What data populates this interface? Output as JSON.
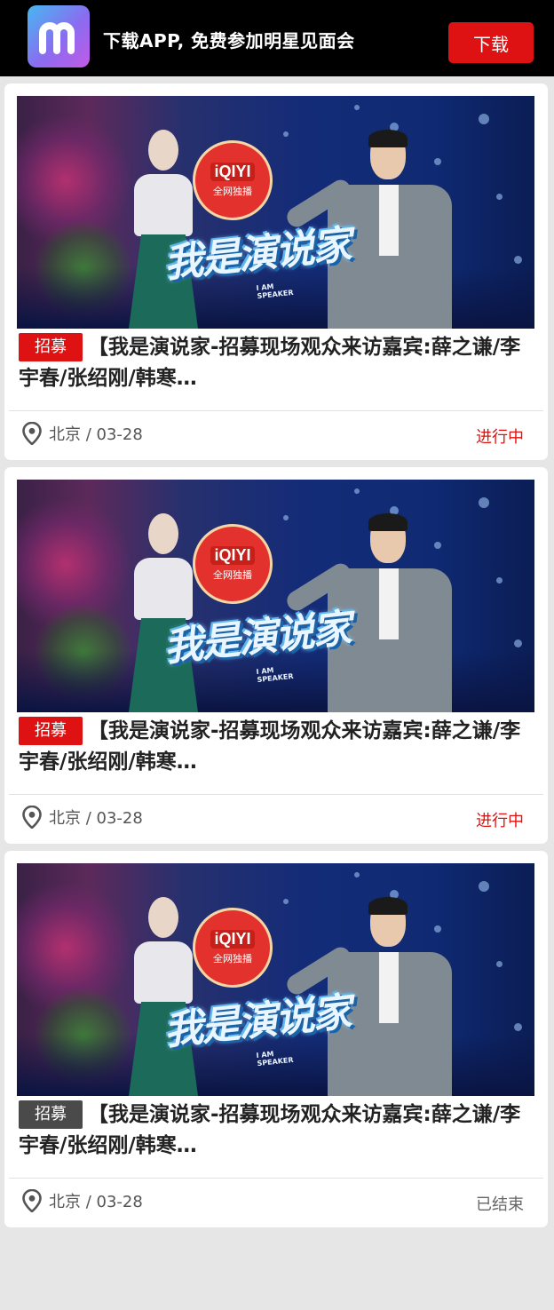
{
  "topbar": {
    "logo_letter": "m",
    "promo_text": "下载APP, 免费参加明星见面会",
    "download_label": "下载"
  },
  "colors": {
    "accent_red": "#de1212",
    "tag_active": "#de1212",
    "tag_ended": "#4a4a4a",
    "status_active": "#de1212",
    "status_ended": "#666666"
  },
  "banner": {
    "brand_logo": "iQIYI",
    "brand_sub": "全网独播",
    "show_title": "我是演说家",
    "show_sub_line1": "I AM",
    "show_sub_line2": "SPEAKER"
  },
  "cards": [
    {
      "tag": "招募",
      "title": "【我是演说家-招募现场观众来访嘉宾:薛之谦/李宇春/张绍刚/韩寒…",
      "location_date": "北京 / 03-28",
      "status": "进行中",
      "state": "active"
    },
    {
      "tag": "招募",
      "title": "【我是演说家-招募现场观众来访嘉宾:薛之谦/李宇春/张绍刚/韩寒…",
      "location_date": "北京 / 03-28",
      "status": "进行中",
      "state": "active"
    },
    {
      "tag": "招募",
      "title": "【我是演说家-招募现场观众来访嘉宾:薛之谦/李宇春/张绍刚/韩寒…",
      "location_date": "北京 / 03-28",
      "status": "已结束",
      "state": "ended"
    }
  ],
  "icons": {
    "location": "location-pin-icon"
  }
}
